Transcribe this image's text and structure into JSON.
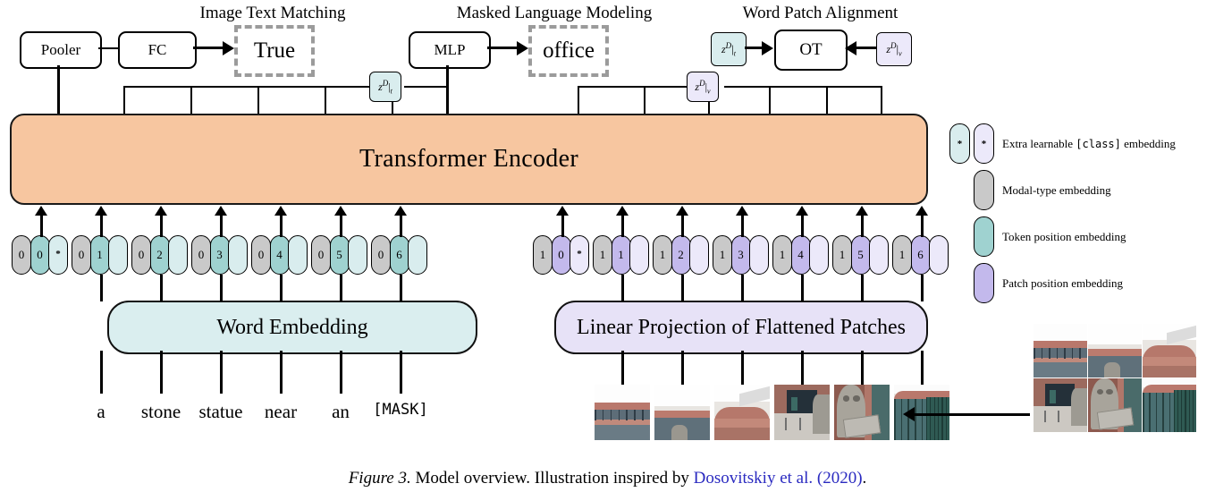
{
  "figure": {
    "caption_label": "Figure 3.",
    "caption_text": " Model overview. Illustration inspired by ",
    "caption_cite": "Dosovitskiy et al. (2020)",
    "caption_end": "."
  },
  "headings": {
    "itm": "Image Text Matching",
    "mlm": "Masked Language Modeling",
    "wpa": "Word Patch Alignment"
  },
  "heads": {
    "pooler": "Pooler",
    "fc": "FC",
    "itm_output": "True",
    "mlp": "MLP",
    "mlm_output": "office",
    "ot": "OT"
  },
  "z_tokens": {
    "text_top": "z^D|_t",
    "vision_top": "z^D|_v",
    "text_bar": "z^D|_t",
    "vision_bar": "z^D|_v",
    "z_symbol": "z",
    "z_sup": "D",
    "z_bar": "|",
    "sub_text": "t",
    "sub_vision": "v"
  },
  "encoder": {
    "label": "Transformer Encoder"
  },
  "embeddings": {
    "word": "Word Embedding",
    "patch": "Linear Projection of Flattened Patches"
  },
  "text_tokens": [
    {
      "modal": "0",
      "pos": "0",
      "extra": "*"
    },
    {
      "modal": "0",
      "pos": "1",
      "extra": ""
    },
    {
      "modal": "0",
      "pos": "2",
      "extra": ""
    },
    {
      "modal": "0",
      "pos": "3",
      "extra": ""
    },
    {
      "modal": "0",
      "pos": "4",
      "extra": ""
    },
    {
      "modal": "0",
      "pos": "5",
      "extra": ""
    },
    {
      "modal": "0",
      "pos": "6",
      "extra": ""
    }
  ],
  "image_tokens": [
    {
      "modal": "1",
      "pos": "0",
      "extra": "*"
    },
    {
      "modal": "1",
      "pos": "1",
      "extra": ""
    },
    {
      "modal": "1",
      "pos": "2",
      "extra": ""
    },
    {
      "modal": "1",
      "pos": "3",
      "extra": ""
    },
    {
      "modal": "1",
      "pos": "4",
      "extra": ""
    },
    {
      "modal": "1",
      "pos": "5",
      "extra": ""
    },
    {
      "modal": "1",
      "pos": "6",
      "extra": ""
    }
  ],
  "words": [
    "a",
    "stone",
    "statue",
    "near",
    "an",
    "[MASK]"
  ],
  "legend": [
    {
      "symbol": "*",
      "label_pre": "Extra learnable ",
      "label_mono": "[class]",
      "label_post": " embedding"
    },
    {
      "symbol": "",
      "label_pre": "Modal-type embedding",
      "label_mono": "",
      "label_post": ""
    },
    {
      "symbol": "",
      "label_pre": "Token position embedding",
      "label_mono": "",
      "label_post": ""
    },
    {
      "symbol": "",
      "label_pre": "Patch position embedding",
      "label_mono": "",
      "label_post": ""
    }
  ],
  "colors": {
    "encoder": "#f7c6a0",
    "modal_type": "#c9c9c9",
    "token_position": "#9fd2d0",
    "patch_position": "#c3b9ec",
    "class_text": "#d9edee",
    "class_patch": "#ece9fa",
    "word_embedding": "#daeeef",
    "linear_projection": "#e7e2f7",
    "cite_link": "#2a2ac0",
    "dashed_border": "#9b9b9b"
  }
}
